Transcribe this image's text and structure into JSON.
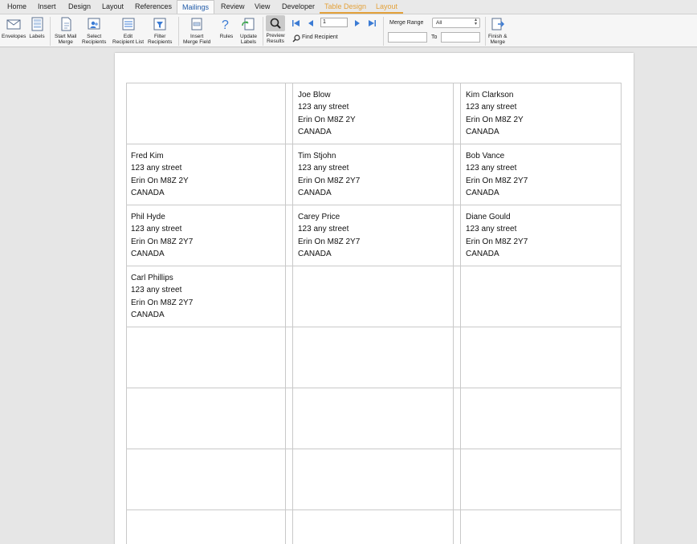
{
  "ribbon_tabs": [
    "Home",
    "Insert",
    "Design",
    "Layout",
    "References",
    "Mailings",
    "Review",
    "View",
    "Developer",
    "Table Design",
    "Layout"
  ],
  "active_tab": "Mailings",
  "buttons": {
    "envelopes": "Envelopes",
    "labels": "Labels",
    "start_mail_merge": [
      "Start Mail",
      "Merge"
    ],
    "select_recipients": [
      "Select",
      "Recipients"
    ],
    "edit_recipient_list": [
      "Edit",
      "Recipient List"
    ],
    "filter_recipients": [
      "Filter",
      "Recipients"
    ],
    "insert_merge_field": [
      "Insert",
      "Merge Field"
    ],
    "rules": "Rules",
    "update_labels": [
      "Update",
      "Labels"
    ],
    "preview_results": [
      "Preview",
      "Results"
    ],
    "find_recipient": "Find Recipient",
    "finish_merge": [
      "Finish &",
      "Merge"
    ]
  },
  "record_number": "1",
  "merge_range": {
    "label": "Merge Range",
    "value": "All",
    "to_label": "To"
  },
  "labels": [
    {
      "lines": [
        "",
        "",
        "",
        ""
      ]
    },
    {
      "lines": [
        "Joe Blow",
        "123 any street",
        "Erin On M8Z 2Y",
        "CANADA"
      ]
    },
    {
      "lines": [
        "Kim Clarkson",
        "123 any street",
        "Erin On M8Z 2Y",
        "CANADA"
      ]
    },
    {
      "lines": [
        "Fred Kim",
        "123 any street",
        "Erin On M8Z 2Y",
        "CANADA"
      ]
    },
    {
      "lines": [
        "Tim Stjohn",
        "123 any street",
        "Erin On M8Z 2Y7",
        "CANADA"
      ]
    },
    {
      "lines": [
        "Bob Vance",
        "123 any street",
        "Erin On M8Z 2Y7",
        "CANADA"
      ]
    },
    {
      "lines": [
        "Phil Hyde",
        "123 any street",
        "Erin On M8Z 2Y7",
        "CANADA"
      ]
    },
    {
      "lines": [
        "Carey Price",
        "123 any street",
        "Erin On M8Z 2Y7",
        "CANADA"
      ]
    },
    {
      "lines": [
        "Diane Gould",
        "123 any street",
        "Erin On M8Z 2Y7",
        "CANADA"
      ]
    },
    {
      "lines": [
        "Carl Phillips",
        "123 any street",
        "Erin On M8Z 2Y7",
        "CANADA"
      ]
    }
  ]
}
